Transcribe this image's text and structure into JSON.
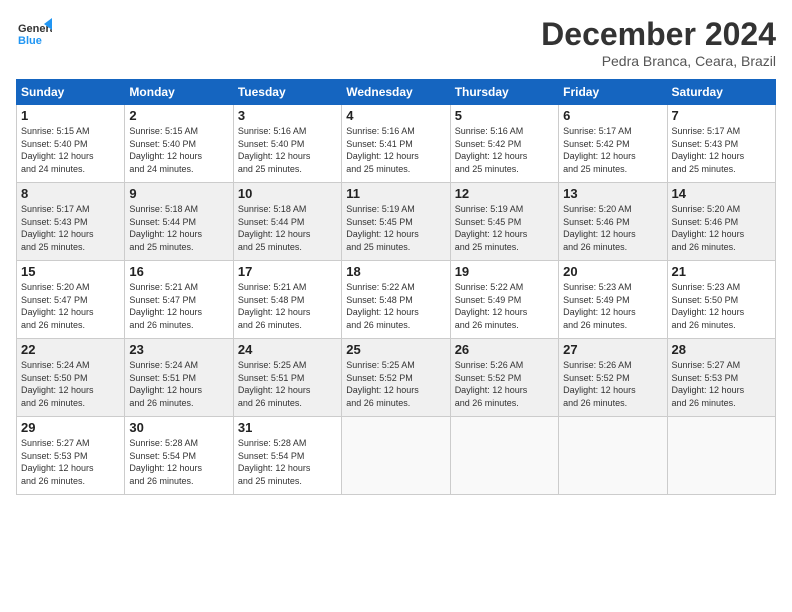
{
  "header": {
    "logo_line1": "General",
    "logo_line2": "Blue",
    "month": "December 2024",
    "location": "Pedra Branca, Ceara, Brazil"
  },
  "weekdays": [
    "Sunday",
    "Monday",
    "Tuesday",
    "Wednesday",
    "Thursday",
    "Friday",
    "Saturday"
  ],
  "weeks": [
    [
      {
        "day": "1",
        "info": "Sunrise: 5:15 AM\nSunset: 5:40 PM\nDaylight: 12 hours\nand 24 minutes."
      },
      {
        "day": "2",
        "info": "Sunrise: 5:15 AM\nSunset: 5:40 PM\nDaylight: 12 hours\nand 24 minutes."
      },
      {
        "day": "3",
        "info": "Sunrise: 5:16 AM\nSunset: 5:40 PM\nDaylight: 12 hours\nand 25 minutes."
      },
      {
        "day": "4",
        "info": "Sunrise: 5:16 AM\nSunset: 5:41 PM\nDaylight: 12 hours\nand 25 minutes."
      },
      {
        "day": "5",
        "info": "Sunrise: 5:16 AM\nSunset: 5:42 PM\nDaylight: 12 hours\nand 25 minutes."
      },
      {
        "day": "6",
        "info": "Sunrise: 5:17 AM\nSunset: 5:42 PM\nDaylight: 12 hours\nand 25 minutes."
      },
      {
        "day": "7",
        "info": "Sunrise: 5:17 AM\nSunset: 5:43 PM\nDaylight: 12 hours\nand 25 minutes."
      }
    ],
    [
      {
        "day": "8",
        "info": "Sunrise: 5:17 AM\nSunset: 5:43 PM\nDaylight: 12 hours\nand 25 minutes."
      },
      {
        "day": "9",
        "info": "Sunrise: 5:18 AM\nSunset: 5:44 PM\nDaylight: 12 hours\nand 25 minutes."
      },
      {
        "day": "10",
        "info": "Sunrise: 5:18 AM\nSunset: 5:44 PM\nDaylight: 12 hours\nand 25 minutes."
      },
      {
        "day": "11",
        "info": "Sunrise: 5:19 AM\nSunset: 5:45 PM\nDaylight: 12 hours\nand 25 minutes."
      },
      {
        "day": "12",
        "info": "Sunrise: 5:19 AM\nSunset: 5:45 PM\nDaylight: 12 hours\nand 25 minutes."
      },
      {
        "day": "13",
        "info": "Sunrise: 5:20 AM\nSunset: 5:46 PM\nDaylight: 12 hours\nand 26 minutes."
      },
      {
        "day": "14",
        "info": "Sunrise: 5:20 AM\nSunset: 5:46 PM\nDaylight: 12 hours\nand 26 minutes."
      }
    ],
    [
      {
        "day": "15",
        "info": "Sunrise: 5:20 AM\nSunset: 5:47 PM\nDaylight: 12 hours\nand 26 minutes."
      },
      {
        "day": "16",
        "info": "Sunrise: 5:21 AM\nSunset: 5:47 PM\nDaylight: 12 hours\nand 26 minutes."
      },
      {
        "day": "17",
        "info": "Sunrise: 5:21 AM\nSunset: 5:48 PM\nDaylight: 12 hours\nand 26 minutes."
      },
      {
        "day": "18",
        "info": "Sunrise: 5:22 AM\nSunset: 5:48 PM\nDaylight: 12 hours\nand 26 minutes."
      },
      {
        "day": "19",
        "info": "Sunrise: 5:22 AM\nSunset: 5:49 PM\nDaylight: 12 hours\nand 26 minutes."
      },
      {
        "day": "20",
        "info": "Sunrise: 5:23 AM\nSunset: 5:49 PM\nDaylight: 12 hours\nand 26 minutes."
      },
      {
        "day": "21",
        "info": "Sunrise: 5:23 AM\nSunset: 5:50 PM\nDaylight: 12 hours\nand 26 minutes."
      }
    ],
    [
      {
        "day": "22",
        "info": "Sunrise: 5:24 AM\nSunset: 5:50 PM\nDaylight: 12 hours\nand 26 minutes."
      },
      {
        "day": "23",
        "info": "Sunrise: 5:24 AM\nSunset: 5:51 PM\nDaylight: 12 hours\nand 26 minutes."
      },
      {
        "day": "24",
        "info": "Sunrise: 5:25 AM\nSunset: 5:51 PM\nDaylight: 12 hours\nand 26 minutes."
      },
      {
        "day": "25",
        "info": "Sunrise: 5:25 AM\nSunset: 5:52 PM\nDaylight: 12 hours\nand 26 minutes."
      },
      {
        "day": "26",
        "info": "Sunrise: 5:26 AM\nSunset: 5:52 PM\nDaylight: 12 hours\nand 26 minutes."
      },
      {
        "day": "27",
        "info": "Sunrise: 5:26 AM\nSunset: 5:52 PM\nDaylight: 12 hours\nand 26 minutes."
      },
      {
        "day": "28",
        "info": "Sunrise: 5:27 AM\nSunset: 5:53 PM\nDaylight: 12 hours\nand 26 minutes."
      }
    ],
    [
      {
        "day": "29",
        "info": "Sunrise: 5:27 AM\nSunset: 5:53 PM\nDaylight: 12 hours\nand 26 minutes."
      },
      {
        "day": "30",
        "info": "Sunrise: 5:28 AM\nSunset: 5:54 PM\nDaylight: 12 hours\nand 26 minutes."
      },
      {
        "day": "31",
        "info": "Sunrise: 5:28 AM\nSunset: 5:54 PM\nDaylight: 12 hours\nand 25 minutes."
      },
      {
        "day": "",
        "info": ""
      },
      {
        "day": "",
        "info": ""
      },
      {
        "day": "",
        "info": ""
      },
      {
        "day": "",
        "info": ""
      }
    ]
  ]
}
